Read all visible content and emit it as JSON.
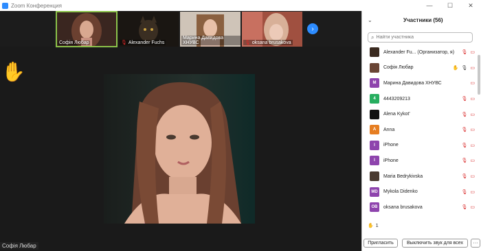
{
  "window": {
    "title": "Zoom Конференция",
    "controls": [
      "—",
      "☐",
      "✕"
    ]
  },
  "video_strip": {
    "thumbnails": [
      {
        "name": "Софія Любар",
        "muted": false,
        "active": true,
        "bg": "#5a3a30"
      },
      {
        "name": "Alexander Fuchs",
        "muted": true,
        "active": false,
        "bg": "#2a2520"
      },
      {
        "name": "Марина Давидова ХНУВС",
        "muted": false,
        "active": false,
        "bg": "#8a6a55"
      },
      {
        "name": "oksana brusakova",
        "muted": true,
        "active": false,
        "bg": "#b07060"
      }
    ],
    "next_icon": "›"
  },
  "main_video": {
    "speaker_name": "Софія Любар"
  },
  "raised_hand_icon": "✋",
  "participants_panel": {
    "collapse_icon": "⌄",
    "title": "Участники (56)",
    "search_placeholder": "Найти участника",
    "search_icon": "⌕",
    "participants": [
      {
        "name": "Alexander Fu... (Организатор, я)",
        "avatar": "",
        "avatar_color": "#3a2a20",
        "hand": false,
        "mic": "muted"
      },
      {
        "name": "Софія Любар",
        "avatar": "",
        "avatar_color": "#6a4535",
        "hand": true,
        "mic": "on"
      },
      {
        "name": "Марина Давидова ХНУВС",
        "avatar": "M",
        "avatar_color": "#8e44ad",
        "hand": false,
        "mic": "none"
      },
      {
        "name": "4443209213",
        "avatar": "4",
        "avatar_color": "#27ae60",
        "hand": false,
        "mic": "muted"
      },
      {
        "name": "Alena Kykot'",
        "avatar": "",
        "avatar_color": "#111111",
        "hand": false,
        "mic": "muted"
      },
      {
        "name": "Anna",
        "avatar": "A",
        "avatar_color": "#e67e22",
        "hand": false,
        "mic": "muted"
      },
      {
        "name": "iPhone",
        "avatar": "I",
        "avatar_color": "#8e44ad",
        "hand": false,
        "mic": "muted"
      },
      {
        "name": "iPhone",
        "avatar": "I",
        "avatar_color": "#8e44ad",
        "hand": false,
        "mic": "muted"
      },
      {
        "name": "Maria Bedrykivska",
        "avatar": "",
        "avatar_color": "#4a3a30",
        "hand": false,
        "mic": "muted"
      },
      {
        "name": "Mykola Didenko",
        "avatar": "MD",
        "avatar_color": "#8e44ad",
        "hand": false,
        "mic": "muted"
      },
      {
        "name": "oksana brusakova",
        "avatar": "OB",
        "avatar_color": "#8e44ad",
        "hand": false,
        "mic": "muted"
      }
    ],
    "raised_hands_count": "1",
    "invite_button": "Пригласить",
    "mute_all_button": "Выключить звук для всех",
    "more_button": "···"
  },
  "colors": {
    "accent": "#2d8cff",
    "active_border": "#8bc34a",
    "muted": "#d92c2c",
    "hand": "#f4b400"
  }
}
